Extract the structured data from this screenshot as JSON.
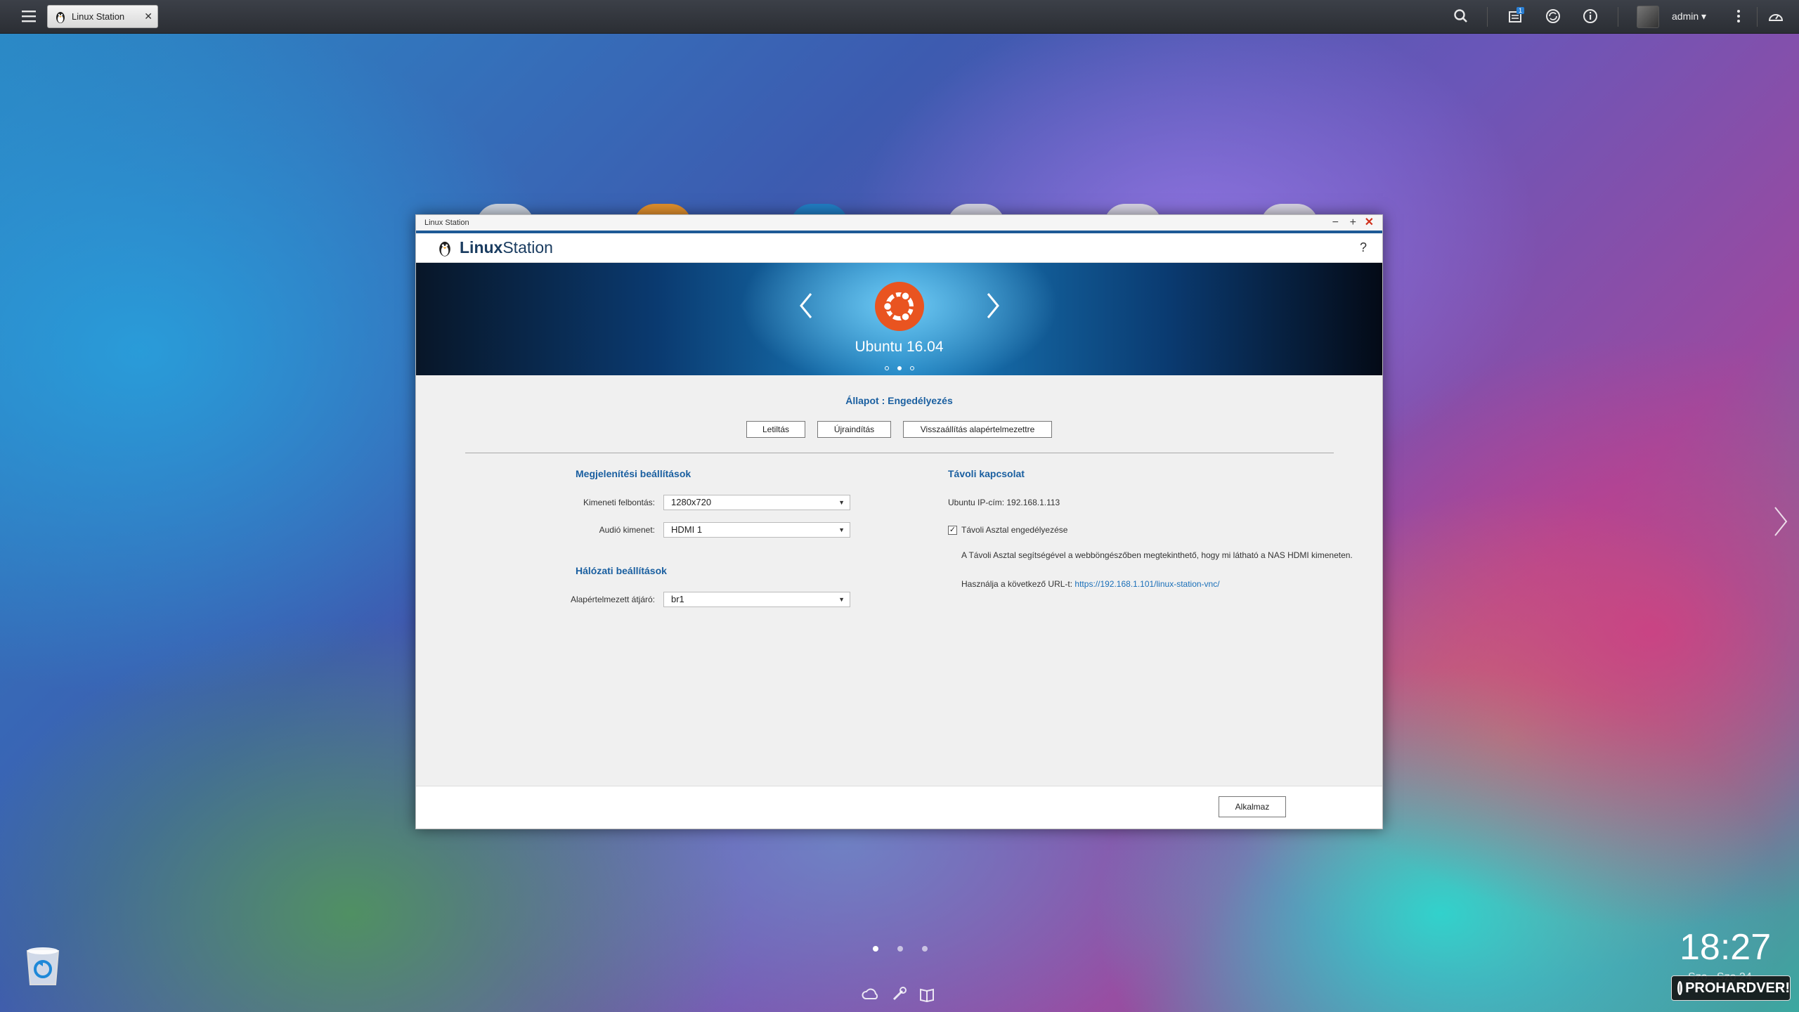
{
  "taskbar": {
    "task_label": "Linux Station",
    "user_label": "admin ▾",
    "notification_count": "1"
  },
  "window": {
    "title": "Linux Station",
    "app_name_bold": "Linux",
    "app_name_rest": "Station",
    "help": "?",
    "distro": "Ubuntu 16.04",
    "status": "Állapot : Engedélyezés",
    "buttons": {
      "stop": "Letiltás",
      "restart": "Újraindítás",
      "reset": "Visszaállítás alapértelmezettre"
    },
    "display_settings": {
      "heading": "Megjelenítési beállítások",
      "resolution_label": "Kimeneti felbontás:",
      "resolution_value": "1280x720",
      "audio_label": "Audió kimenet:",
      "audio_value": "HDMI 1"
    },
    "network_settings": {
      "heading": "Hálózati beállítások",
      "gateway_label": "Alapértelmezett átjáró:",
      "gateway_value": "br1"
    },
    "remote": {
      "heading": "Távoli kapcsolat",
      "ip_label": "Ubuntu IP-cím:",
      "ip_value": "192.168.1.113",
      "checkbox_label": "Távoli Asztal engedélyezése",
      "checkbox_checked": true,
      "description": "A Távoli Asztal segítségével a webböngészőben megtekinthető, hogy mi látható a NAS HDMI kimeneten.",
      "url_prefix": "Használja a következő URL-t:",
      "url": "https://192.168.1.101/linux-station-vnc/"
    },
    "apply": "Alkalmaz"
  },
  "desktop": {
    "clock": "18:27",
    "date": "Szo., Szo 24",
    "watermark": "PROHARDVER!"
  },
  "colors": {
    "accent": "#1a5fa0",
    "ubuntu": "#e95420",
    "close": "#d0301b"
  }
}
